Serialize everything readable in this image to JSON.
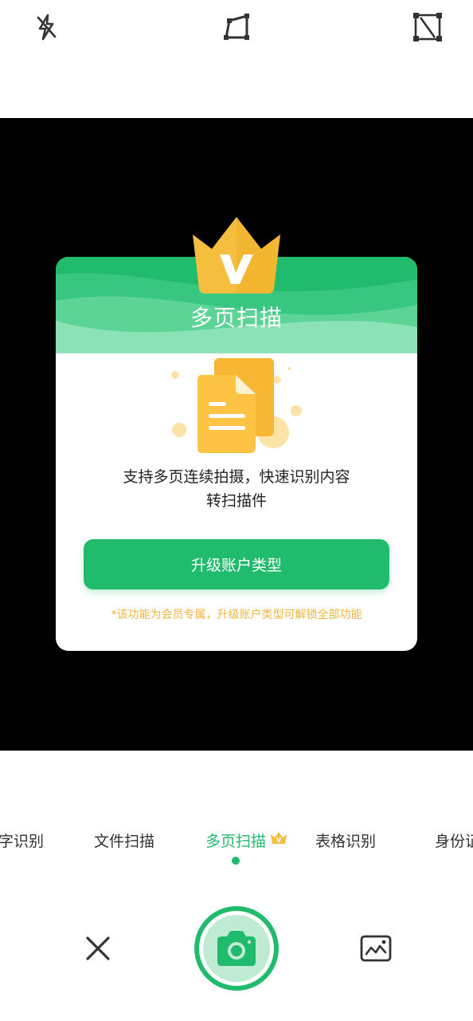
{
  "toolbar": {
    "flash_icon": "flash-off-icon",
    "crop_icon": "crop-edge-icon",
    "auto_crop_icon": "auto-crop-off-icon"
  },
  "popup": {
    "title": "多页扫描",
    "badge_icon": "vip-crown-icon",
    "illustration": "documents-icon",
    "description_line1": "支持多页连续拍摄，快速识别内容",
    "description_line2": "转扫描件",
    "upgrade_label": "升级账户类型",
    "note": "*该功能为会员专属，升级账户类型可解锁全部功能"
  },
  "modes": {
    "items": [
      "字识别",
      "文件扫描",
      "多页扫描",
      "表格识别",
      "身份证"
    ],
    "selected": "多页扫描"
  },
  "bottom": {
    "close_icon": "close-icon",
    "shutter_icon": "camera-icon",
    "gallery_icon": "gallery-icon"
  },
  "colors": {
    "accent": "#21bb6d",
    "gold": "#f6be3f",
    "note": "#f0b63f"
  }
}
